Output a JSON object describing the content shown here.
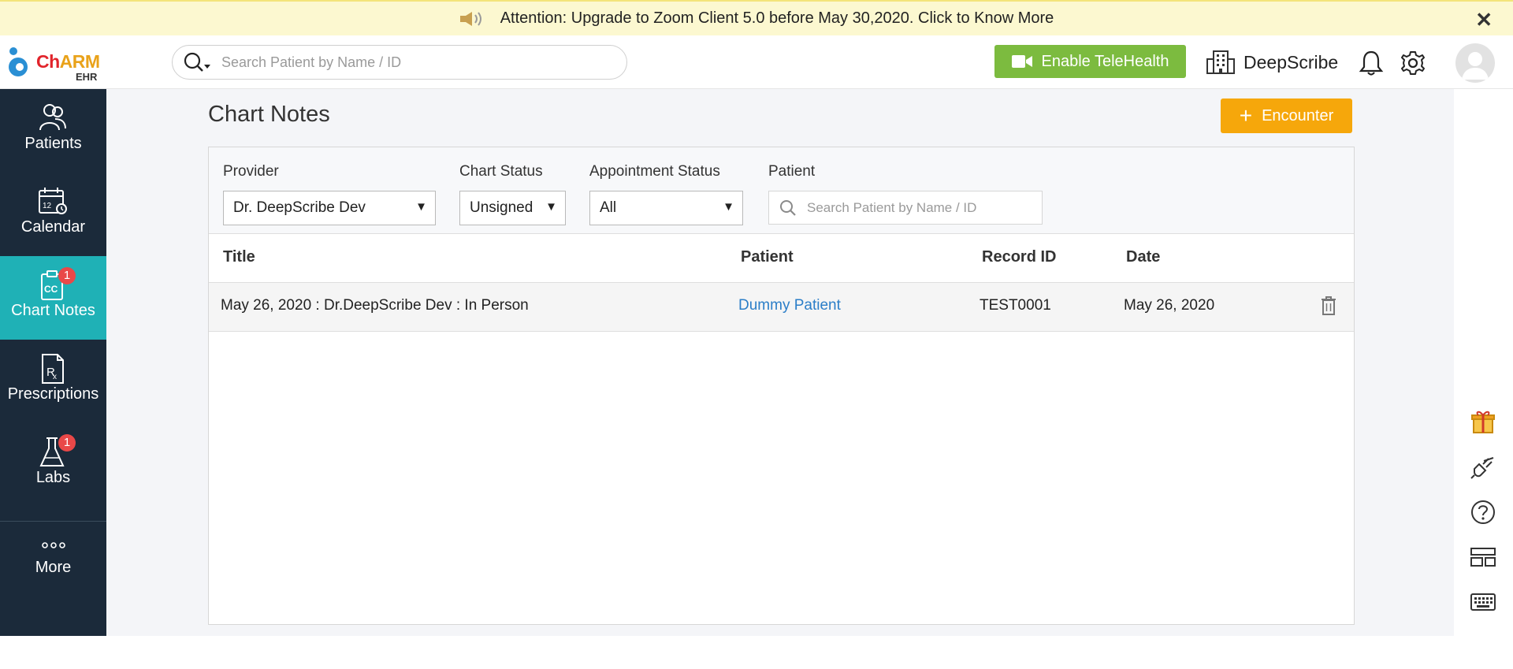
{
  "banner": {
    "message": "Attention: Upgrade to Zoom Client 5.0 before May 30,2020. Click to Know More",
    "close_label": "✕"
  },
  "header": {
    "logo": {
      "brand_ch": "Ch",
      "brand_arm": "ARM",
      "sub": "EHR"
    },
    "search_placeholder": "Search Patient by Name / ID",
    "telehealth_label": "Enable TeleHealth",
    "practice_name": "DeepScribe"
  },
  "sidebar": {
    "items": [
      {
        "label": "Patients",
        "icon": "patients-icon"
      },
      {
        "label": "Calendar",
        "icon": "calendar-icon"
      },
      {
        "label": "Chart Notes",
        "icon": "chart-notes-icon",
        "badge": "1",
        "active": true
      },
      {
        "label": "Prescriptions",
        "icon": "prescription-icon"
      },
      {
        "label": "Labs",
        "icon": "flask-icon",
        "badge": "1"
      }
    ],
    "more_label": "More"
  },
  "main": {
    "title": "Chart Notes",
    "encounter_label": "Encounter",
    "filters": {
      "provider": {
        "label": "Provider",
        "value": "Dr. DeepScribe Dev"
      },
      "chart_status": {
        "label": "Chart Status",
        "value": "Unsigned"
      },
      "appointment_status": {
        "label": "Appointment Status",
        "value": "All"
      },
      "patient": {
        "label": "Patient",
        "placeholder": "Search Patient by Name / ID"
      }
    },
    "table": {
      "columns": [
        "Title",
        "Patient",
        "Record ID",
        "Date"
      ],
      "rows": [
        {
          "title": "May 26, 2020 : Dr.DeepScribe Dev : In Person",
          "patient": "Dummy Patient",
          "record_id": "TEST0001",
          "date": "May 26, 2020"
        }
      ]
    }
  },
  "rail": {
    "icons": [
      "gift-icon",
      "plug-icon",
      "help-icon",
      "layout-icon",
      "keyboard-icon"
    ]
  },
  "colors": {
    "banner_bg": "#fcf8d0",
    "sidebar_bg": "#1b2a3a",
    "active_nav": "#1fb1b6",
    "telehealth": "#7cbb3f",
    "encounter": "#f6a70b",
    "link": "#2b7ec8",
    "badge": "#e94848"
  }
}
